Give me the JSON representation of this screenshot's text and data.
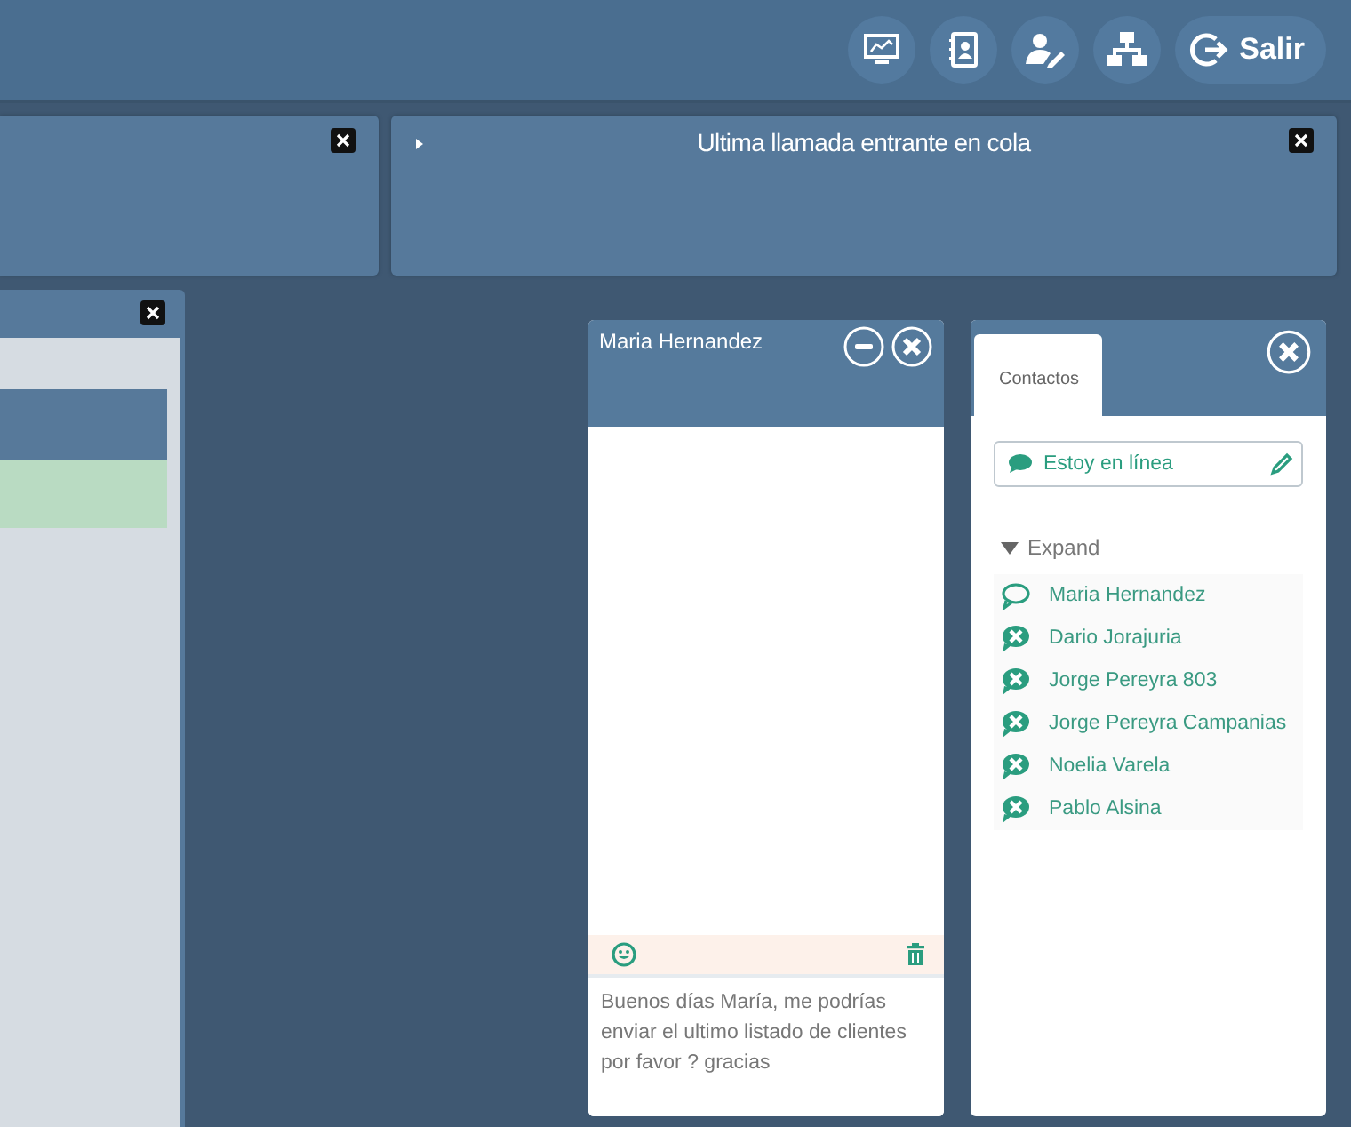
{
  "toolbar": {
    "exit_label": "Salir"
  },
  "queue_panel": {
    "title": "Ultima llamada entrante en cola",
    "expanded": false
  },
  "chat": {
    "title": "Maria Hernandez",
    "message": "Buenos días María, me podrías enviar el ultimo listado de clientes por favor ? gracias"
  },
  "contacts_panel": {
    "tabs": [
      {
        "label": "Contactos",
        "selected": true
      }
    ],
    "status": "Estoy en línea",
    "group": {
      "label": "Expand",
      "expanded": true,
      "contacts": [
        {
          "name": "Maria Hernandez",
          "online": true
        },
        {
          "name": "Dario Jorajuria",
          "online": false
        },
        {
          "name": "Jorge Pereyra 803",
          "online": false
        },
        {
          "name": "Jorge Pereyra Campanias",
          "online": false
        },
        {
          "name": "Noelia Varela",
          "online": false
        },
        {
          "name": "Pablo Alsina",
          "online": false
        }
      ]
    }
  }
}
